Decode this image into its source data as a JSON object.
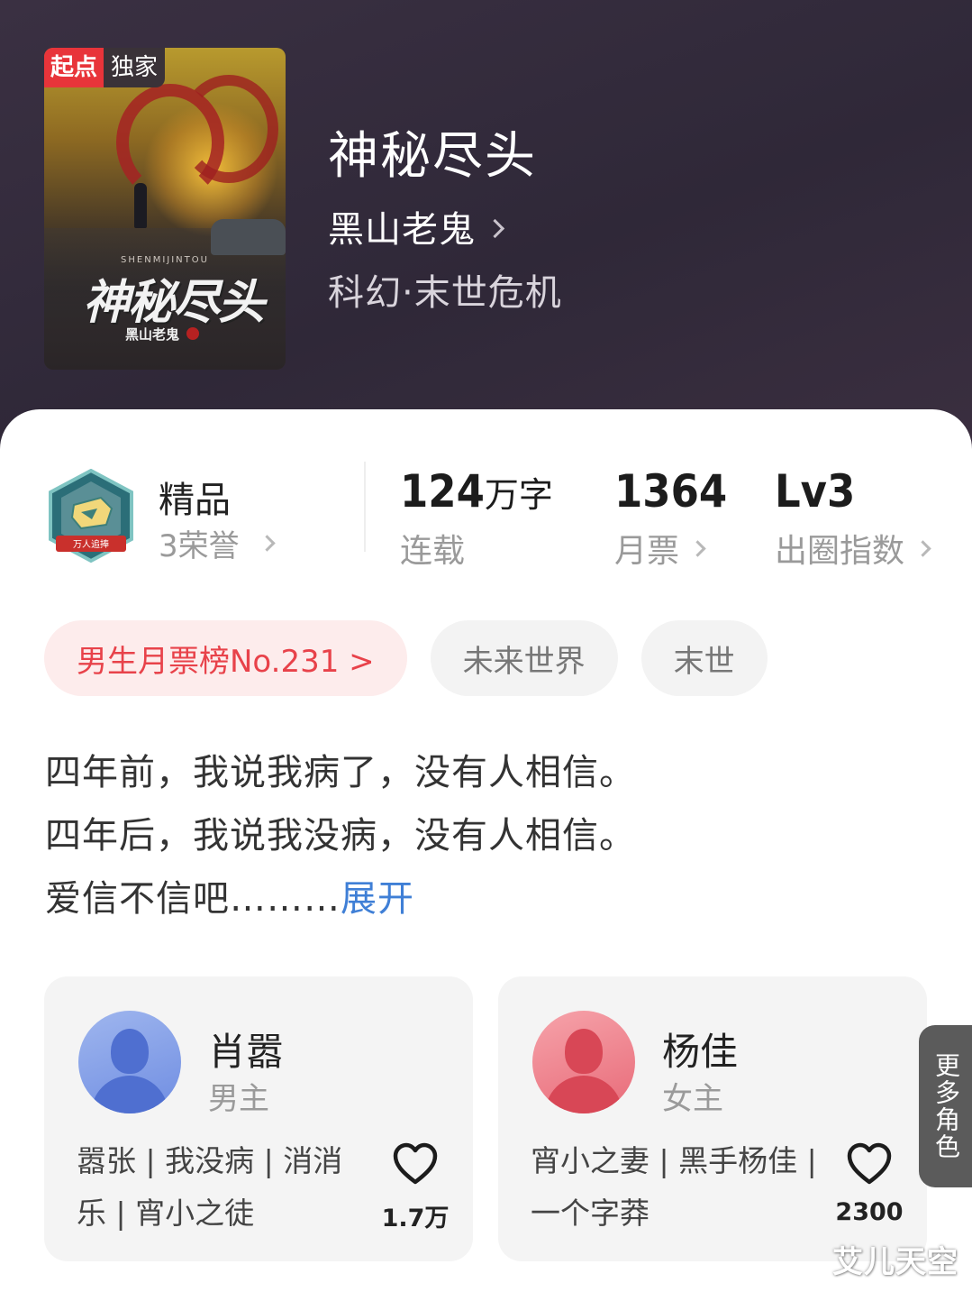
{
  "book": {
    "badge_source": "起点",
    "badge_exclusive": "独家",
    "cover_pinyin": "SHENMIJINTOU",
    "cover_title": "神秘尽头",
    "cover_author": "黑山老鬼",
    "title": "神秘尽头",
    "author": "黑山老鬼",
    "genre": "科幻·末世危机"
  },
  "honor": {
    "medal_text": "万人追捧",
    "title": "精品",
    "count": "3荣誉"
  },
  "stats": [
    {
      "value": "124",
      "unit": "万字",
      "label": "连载"
    },
    {
      "value": "1364",
      "unit": "",
      "label": "月票"
    },
    {
      "value": "Lv3",
      "unit": "",
      "label": "出圈指数"
    }
  ],
  "tags": {
    "rank": "男生月票榜No.231 >",
    "tag1": "未来世界",
    "tag2": "末世"
  },
  "description": {
    "line1": "四年前，我说我病了，没有人相信。",
    "line2": "四年后，我说我没病，没有人相信。",
    "line3": "爱信不信吧………",
    "expand": "展开"
  },
  "characters": [
    {
      "name": "肖嚣",
      "role": "男主",
      "tags": "嚣张 | 我没病 | 消消乐 | 宵小之徒",
      "likes": "1.7万"
    },
    {
      "name": "杨佳",
      "role": "女主",
      "tags": "宵小之妻 | 黑手杨佳 | 一个字莽",
      "likes": "2300"
    }
  ],
  "more_roles": "更多角色",
  "watermark": "艾儿天空",
  "colors": {
    "accent_red": "#e8424a",
    "link_blue": "#3f7fd6",
    "header_bg": "#2f2838"
  }
}
